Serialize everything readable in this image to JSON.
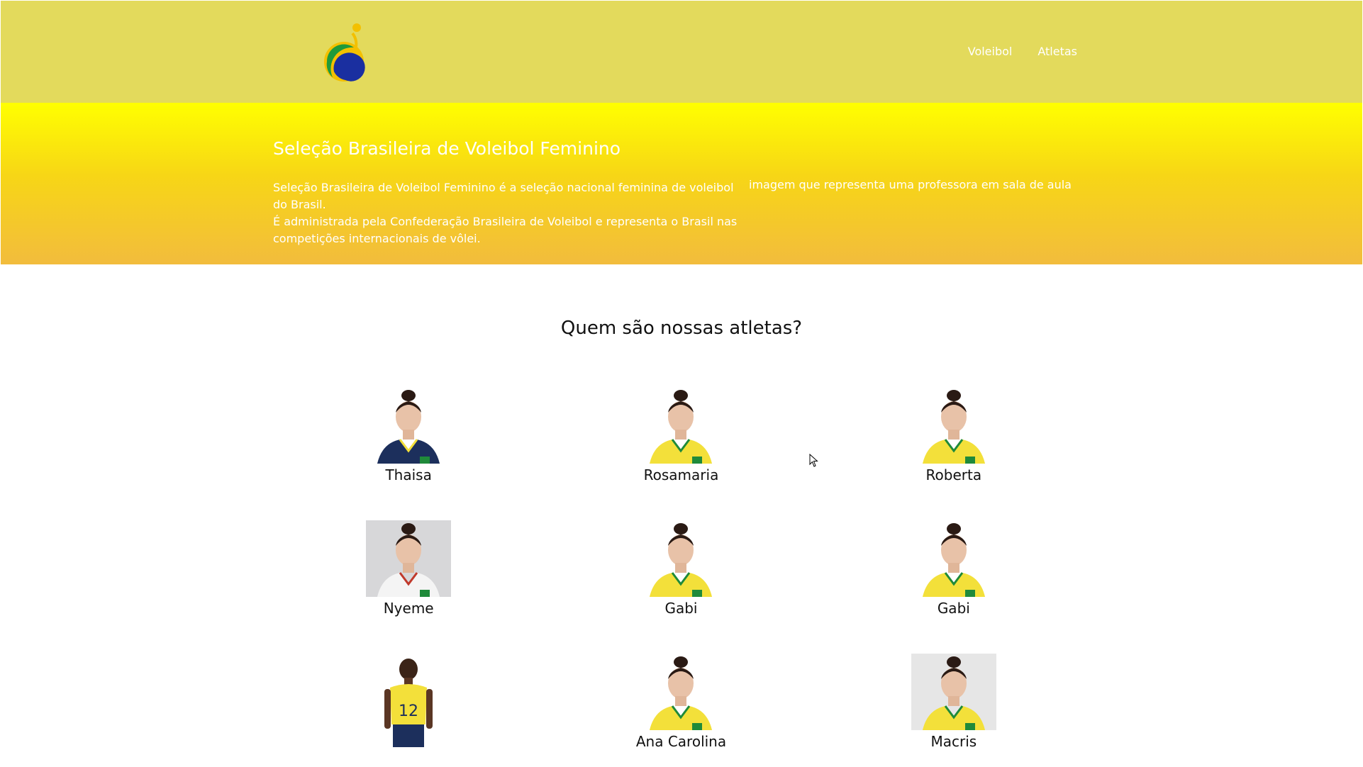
{
  "header": {
    "logo_alt": "logo",
    "nav": [
      {
        "label": "Voleibol"
      },
      {
        "label": "Atletas"
      }
    ]
  },
  "hero": {
    "title": "Seleção Brasileira de Voleibol Feminino",
    "paragraph1": "Seleção Brasileira de Voleibol Feminino é a seleção nacional feminina de voleibol do Brasil.",
    "paragraph2": "É administrada pela Confederação Brasileira de Voleibol e representa o Brasil nas competições internacionais de vôlei.",
    "image_alt": "imagem que representa uma professora em sala de aula"
  },
  "athletes": {
    "title": "Quem são nossas atletas?",
    "items": [
      {
        "name": "Thaisa",
        "jersey": "blue"
      },
      {
        "name": "Rosamaria",
        "jersey": "yellow"
      },
      {
        "name": "Roberta",
        "jersey": "yellow"
      },
      {
        "name": "Nyeme",
        "jersey": "white"
      },
      {
        "name": "Gabi",
        "jersey": "yellow"
      },
      {
        "name": "Gabi",
        "jersey": "yellow"
      },
      {
        "name": "",
        "jersey": "yellow-12"
      },
      {
        "name": "Ana Carolina",
        "jersey": "yellow"
      },
      {
        "name": "Macris",
        "jersey": "yellow"
      }
    ]
  },
  "colors": {
    "header_bg": "#e3da5c",
    "hero_top": "#ffff00",
    "hero_bottom": "#f2bc3d",
    "jersey_yellow": "#f3e03a",
    "jersey_green": "#1f8a3a",
    "jersey_blue": "#1c2f5c"
  }
}
